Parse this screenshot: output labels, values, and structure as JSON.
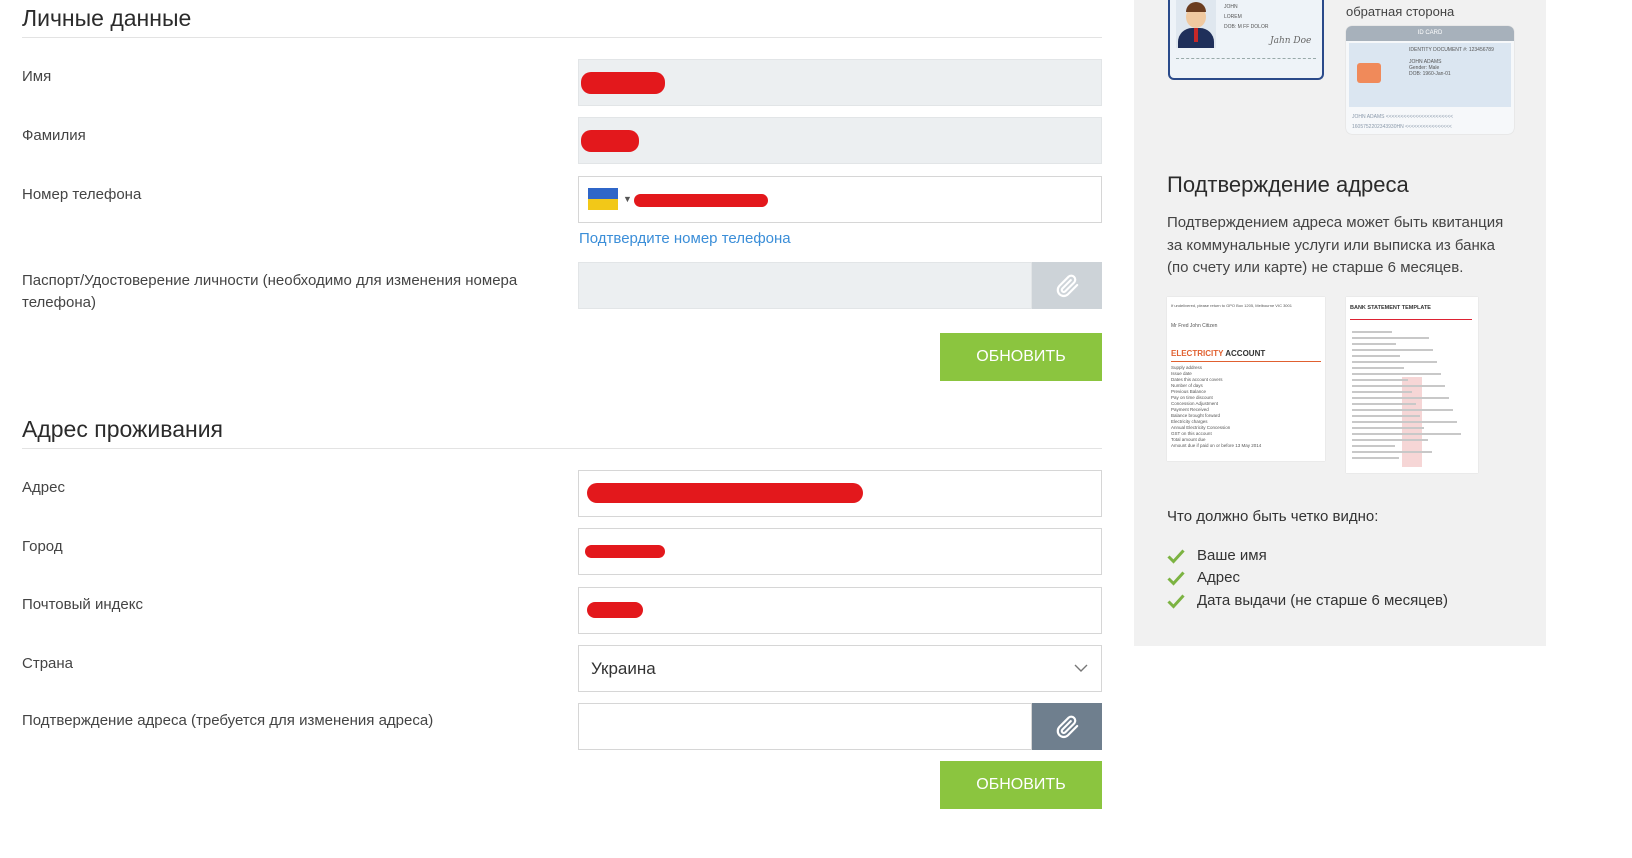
{
  "personal": {
    "title": "Личные данные",
    "first_name_label": "Имя",
    "last_name_label": "Фамилия",
    "phone_label": "Номер телефона",
    "confirm_phone_link": "Подтвердите номер телефона",
    "passport_label": "Паспорт/Удостоверение личности (необходимо для изменения номера телефона)",
    "update_button": "ОБНОВИТЬ"
  },
  "address": {
    "title": "Адрес проживания",
    "address_label": "Адрес",
    "city_label": "Город",
    "postal_label": "Почтовый индекс",
    "country_label": "Страна",
    "country_value": "Украина",
    "proof_label": "Подтверждение адреса (требуется для изменения адреса)",
    "update_button": "ОБНОВИТЬ"
  },
  "sidebar": {
    "back_side_label": "обратная сторона",
    "id_card_header": "ID CARD",
    "id_card_lines": [
      "IDENTITY DOCUMENT #: 123456789",
      "JOHN ADAMS",
      "Gender: Male",
      "DOB: 1960-Jan-01"
    ],
    "id_card_mrz": [
      "JOHN ADAMS <<<<<<<<<<<<<<<<<<<<<<<",
      "1605752202343930HN <<<<<<<<<<<<<<<<"
    ],
    "front_card_lines": [
      "JOHN",
      "LOREM",
      "DOB: M FF DOLOR"
    ],
    "address_title": "Подтверждение адреса",
    "address_text": "Подтверждением адреса может быть квитанция за коммунальные услуги или выписка из банка (по счету или карте) не старше 6 месяцев.",
    "bill_title": "ELECTRICITY ACCOUNT",
    "bill_header": "If undelivered, please return to GPO Box 1205, Melbourne VIC 3001",
    "bill_name": "Mr Fred John Citizen",
    "bill_lines": [
      "Supply address",
      "Issue date",
      "Dates this account covers",
      "Number of days",
      "Previous Balance",
      "Pay on time discount",
      "Concession Adjustment",
      "Payment Received",
      "Balance brought forward",
      "Electricity charges",
      "Annual Electricity Concession",
      "GST on this account",
      "Total amount due",
      "Amount due if paid on or before 13 May 2014"
    ],
    "bank_title": "BANK STATEMENT TEMPLATE",
    "visible_question": "Что должно быть четко видно:",
    "checklist": [
      "Ваше имя",
      "Адрес",
      "Дата выдачи (не старше 6 месяцев)"
    ],
    "check_color": "#7cb342"
  },
  "colors": {
    "accent_button": "#8bc53f",
    "link": "#3b8ed8",
    "redaction": "#e3181c",
    "attach_disabled": "#cdd3d8",
    "attach_active": "#6f7f8e"
  },
  "icons": {
    "attach": "paperclip-icon",
    "dropdown": "chevron-down-icon",
    "check": "check-icon",
    "flag": "ukraine-flag-icon"
  }
}
